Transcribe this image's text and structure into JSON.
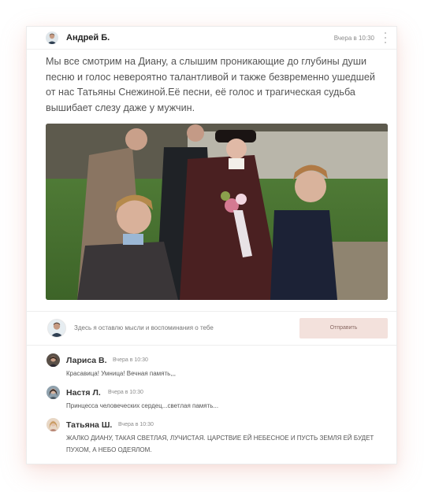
{
  "post": {
    "author": "Андрей Б.",
    "time": "Вчера в 10:30",
    "text": "Мы все смотрим на Диану, а слышим проникающие до глубины души песню и голос невероятно талантливой и также безвременно ушедшей от нас Татьяны Снежиной.Её песни, её голос и трагическая судьба вышибает слезу даже у мужчин."
  },
  "composer": {
    "placeholder": "Здесь я оставлю мысли и воспоминания о тебе",
    "send_label": "Отправить"
  },
  "comments": [
    {
      "name": "Лариса В.",
      "time": "Вчера в 10:30",
      "text": "Красавица! Умница! Вечная память,,,"
    },
    {
      "name": "Настя Л.",
      "time": "Вчера в 10:30",
      "text": "Принцесса человеческих сердец...светлая память..."
    },
    {
      "name": "Татьяна Ш.",
      "time": "Вчера в 10:30",
      "text": "ЖАЛКО ДИАНУ, ТАКАЯ СВЕТЛАЯ, ЛУЧИСТАЯ. ЦАРСТВИЕ ЕЙ  НЕБЕСНОЕ И ПУСТЬ ЗЕМЛЯ ЕЙ БУДЕТ ПУХОМ, А НЕБО ОДЕЯЛОМ."
    }
  ]
}
